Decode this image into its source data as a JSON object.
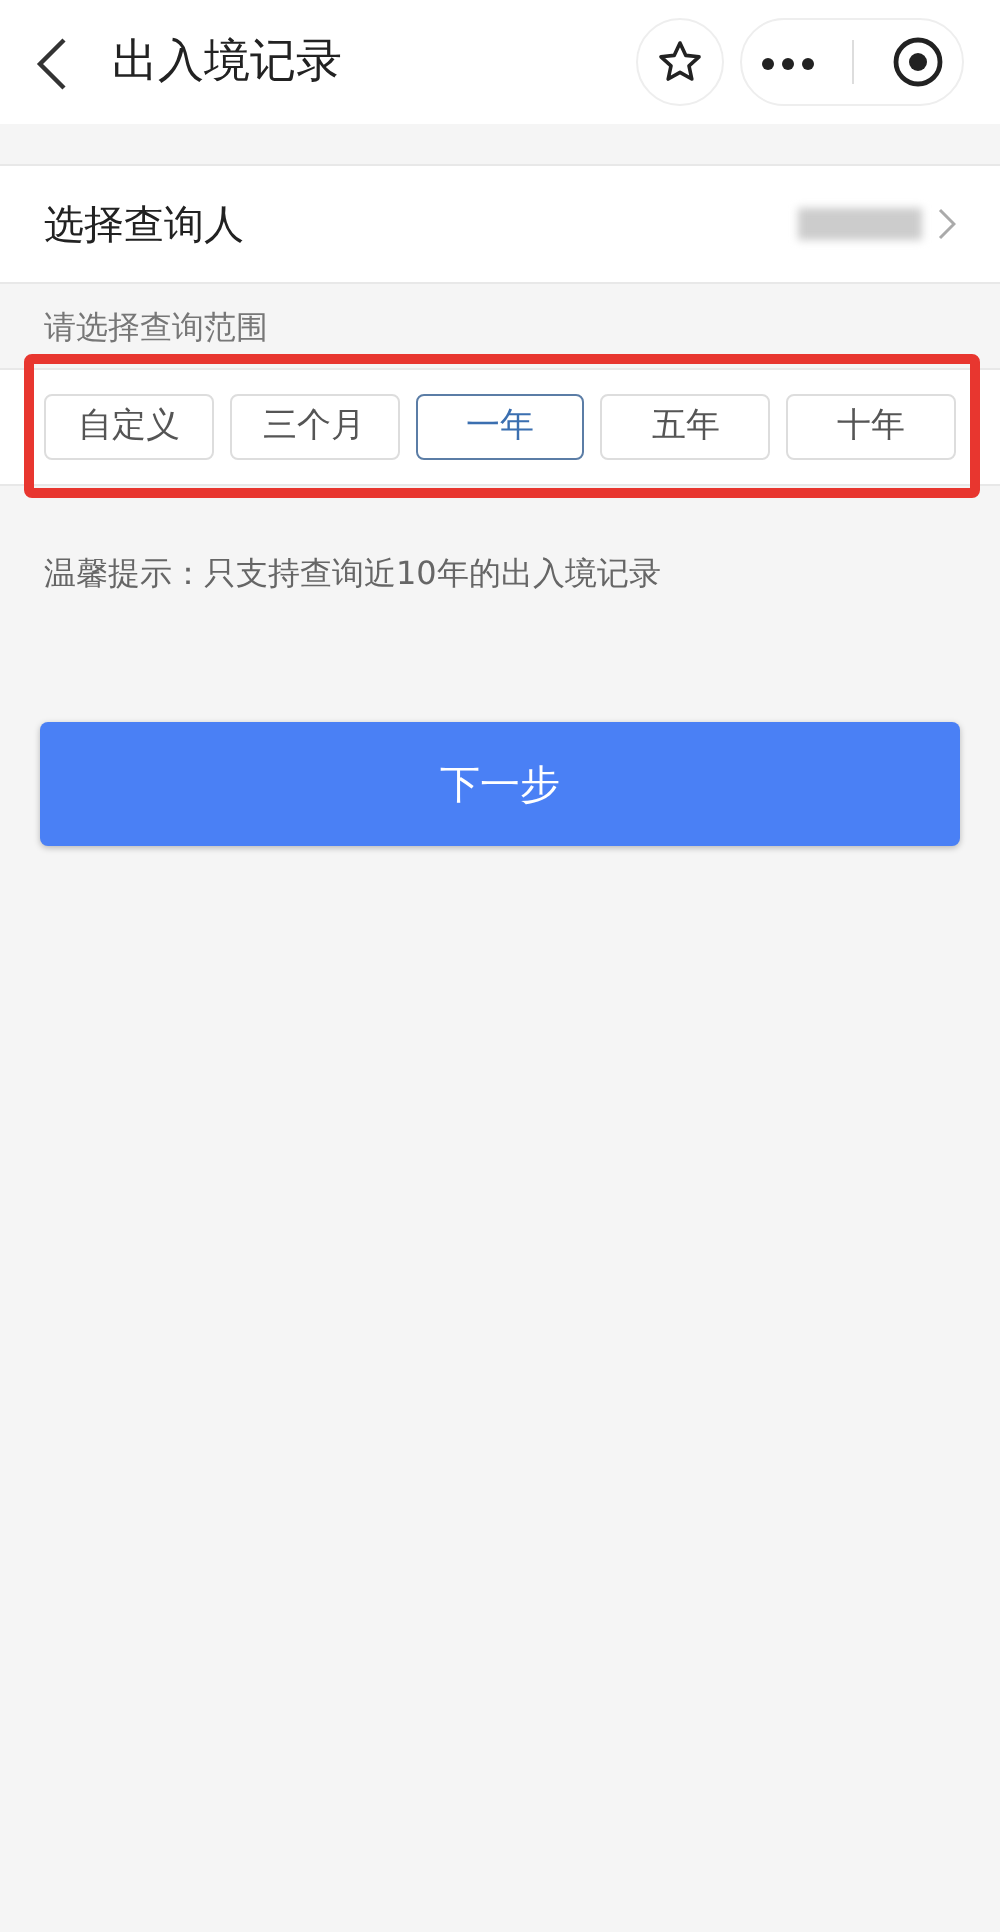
{
  "header": {
    "title": "出入境记录"
  },
  "person_row": {
    "label": "选择查询人"
  },
  "range": {
    "label": "请选择查询范围",
    "highlighted": true,
    "options": [
      {
        "label": "自定义",
        "selected": false
      },
      {
        "label": "三个月",
        "selected": false
      },
      {
        "label": "一年",
        "selected": true
      },
      {
        "label": "五年",
        "selected": false
      },
      {
        "label": "十年",
        "selected": false
      }
    ]
  },
  "hint": "温馨提示：只支持查询近10年的出入境记录",
  "next_button": "下一步"
}
